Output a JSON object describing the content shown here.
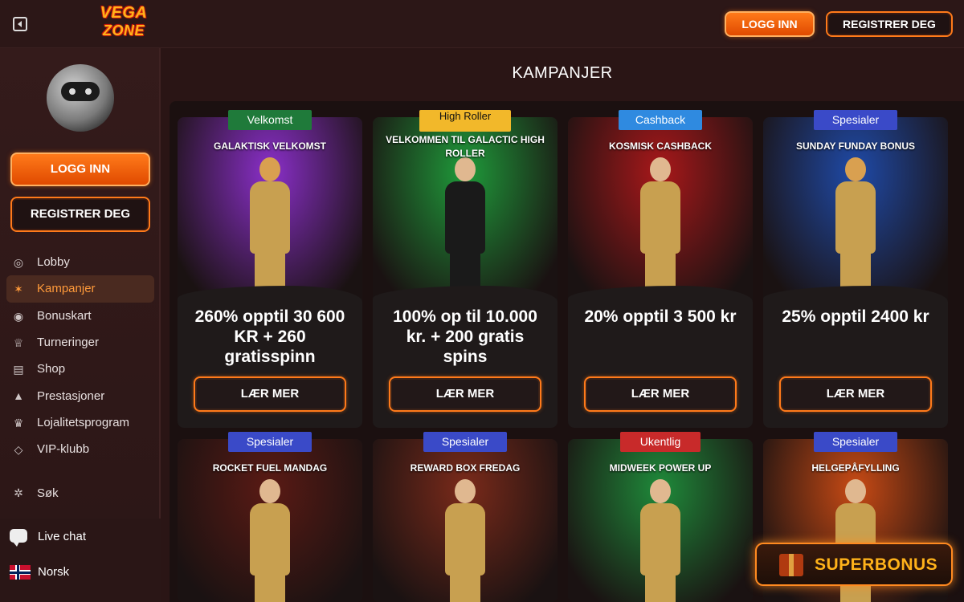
{
  "header": {
    "logo_line1": "VEGA",
    "logo_line2": "ZONE",
    "login": "LOGG INN",
    "register": "REGISTRER DEG"
  },
  "sidebar": {
    "login": "LOGG INN",
    "register": "REGISTRER DEG",
    "items": [
      {
        "label": "Lobby",
        "icon": "globe-icon"
      },
      {
        "label": "Kampanjer",
        "icon": "megaphone-icon"
      },
      {
        "label": "Bonuskart",
        "icon": "radar-icon"
      },
      {
        "label": "Turneringer",
        "icon": "trophy-icon"
      },
      {
        "label": "Shop",
        "icon": "shop-icon"
      },
      {
        "label": "Prestasjoner",
        "icon": "achievement-icon"
      },
      {
        "label": "Lojalitetsprogram",
        "icon": "crown-icon"
      },
      {
        "label": "VIP-klubb",
        "icon": "diamond-icon"
      }
    ],
    "search": "Søk",
    "live_chat": "Live chat",
    "language": "Norsk"
  },
  "main": {
    "title": "KAMPANJER",
    "button_label": "LÆR MER",
    "cards": [
      {
        "tag": "Velkomst",
        "tag_color": "#1f7a3a",
        "subtitle": "GALAKTISK VELKOMST",
        "offer": "260% opptil 30 600 KR + 260 gratisspinn",
        "bg": "#8a2fc9"
      },
      {
        "tag": "High Roller",
        "tag_color": "#f2b82a",
        "subtitle": "VELKOMMEN TIL GALACTIC HIGH ROLLER",
        "offer": "100% op til 10.000 kr. + 200 gratis spins",
        "bg": "#1f9a3a"
      },
      {
        "tag": "Cashback",
        "tag_color": "#2f8ae0",
        "subtitle": "KOSMISK CASHBACK",
        "offer": "20% opptil 3 500 kr",
        "bg": "#a8181a"
      },
      {
        "tag": "Spesialer",
        "tag_color": "#3a4ac8",
        "subtitle": "SUNDAY FUNDAY BONUS",
        "offer": "25% opptil 2400 kr",
        "bg": "#1f4aa8"
      },
      {
        "tag": "Spesialer",
        "tag_color": "#3a4ac8",
        "subtitle": "ROCKET FUEL MANDAG",
        "offer": "",
        "bg": "#5a1a14"
      },
      {
        "tag": "Spesialer",
        "tag_color": "#3a4ac8",
        "subtitle": "REWARD BOX FREDAG",
        "offer": "",
        "bg": "#7a2a1a"
      },
      {
        "tag": "Ukentlig",
        "tag_color": "#c82a2a",
        "subtitle": "MIDWEEK POWER UP",
        "offer": "",
        "bg": "#1f8a3a"
      },
      {
        "tag": "Spesialer",
        "tag_color": "#3a4ac8",
        "subtitle": "HELGEPÅFYLLING",
        "offer": "",
        "bg": "#c84a14"
      }
    ]
  },
  "superbonus": "SUPERBONUS"
}
